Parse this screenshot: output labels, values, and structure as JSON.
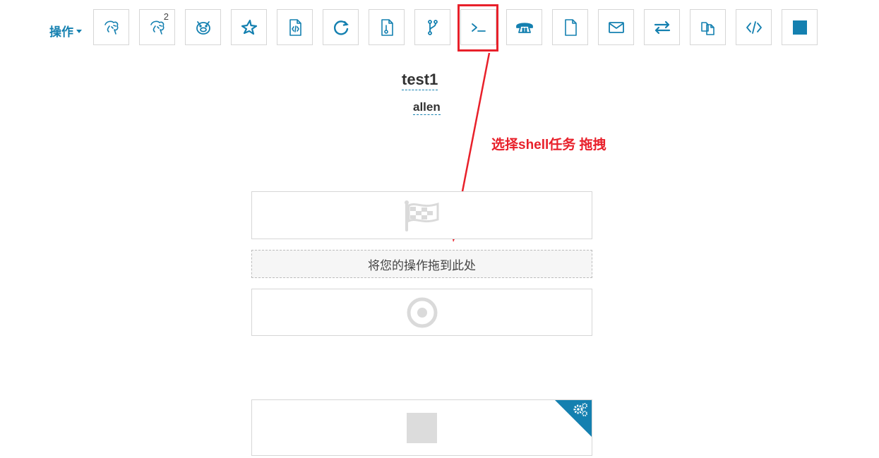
{
  "menu": {
    "label": "操作"
  },
  "toolbar": {
    "tools": [
      {
        "icon": "hive-icon"
      },
      {
        "icon": "hive2-icon",
        "badge": "2"
      },
      {
        "icon": "pig-icon"
      },
      {
        "icon": "spark-icon"
      },
      {
        "icon": "java-icon"
      },
      {
        "icon": "sqoop-icon"
      },
      {
        "icon": "mapreduce-icon"
      },
      {
        "icon": "subworkflow-icon"
      },
      {
        "icon": "shell-icon"
      },
      {
        "icon": "ssh-icon"
      },
      {
        "icon": "hdfs-fs-icon"
      },
      {
        "icon": "email-icon"
      },
      {
        "icon": "streaming-icon"
      },
      {
        "icon": "distcp-icon"
      },
      {
        "icon": "generic-icon"
      },
      {
        "icon": "kill-icon"
      }
    ]
  },
  "workflow": {
    "name": "test1",
    "user": "allen"
  },
  "annotation": {
    "text": "选择shell任务 拖拽"
  },
  "canvas": {
    "drop_text": "将您的操作拖到此处"
  },
  "colors": {
    "accent": "#1480b0",
    "highlight": "#e8202a",
    "muted": "#dcdcdc"
  }
}
